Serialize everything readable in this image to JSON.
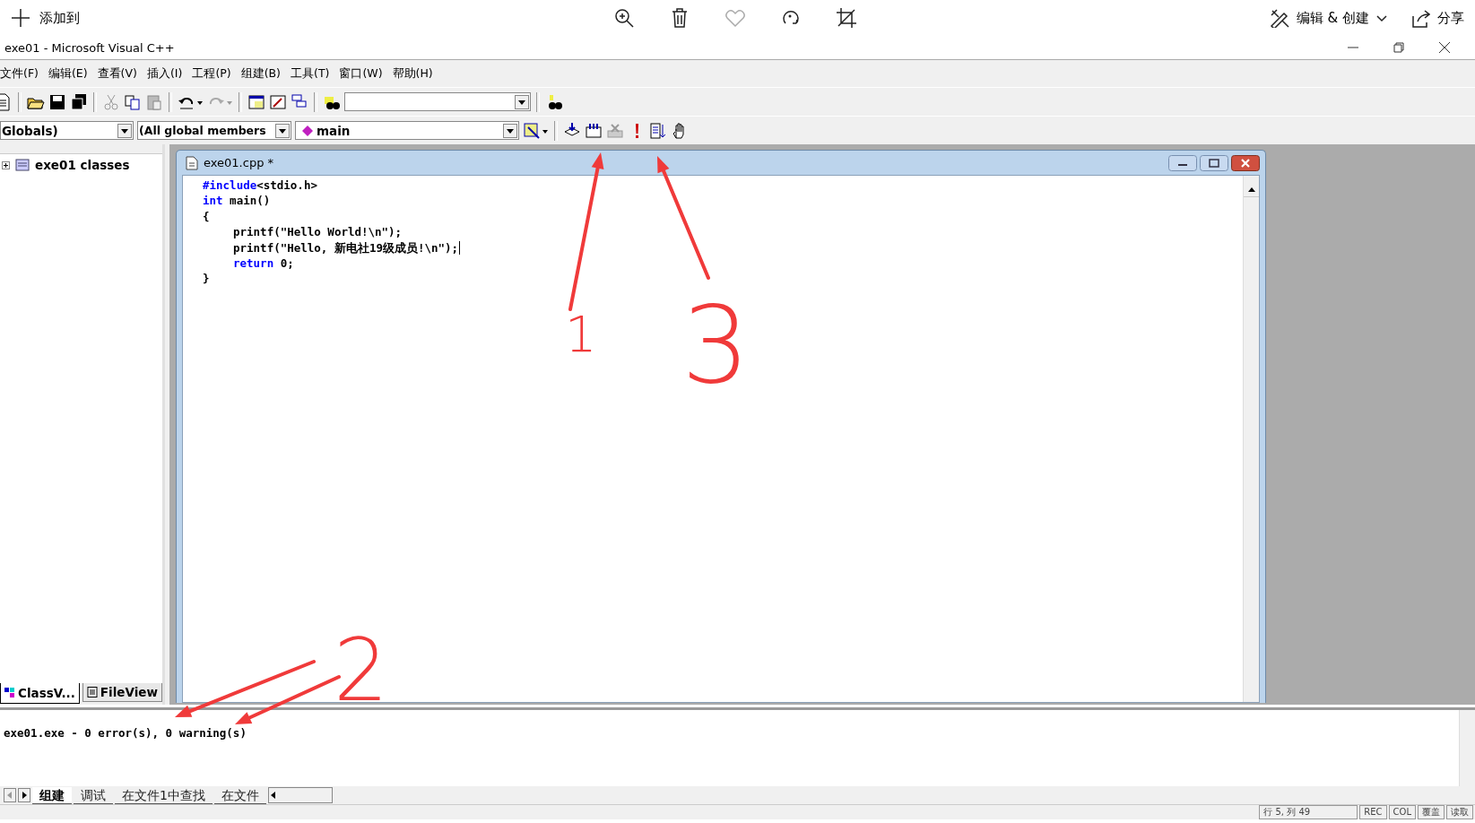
{
  "viewer_bar": {
    "add_label": "添加到",
    "edit_label": "编辑 & 创建",
    "share_label": "分享"
  },
  "window": {
    "title": "exe01 - Microsoft Visual C++"
  },
  "menu": [
    "文件(F)",
    "编辑(E)",
    "查看(V)",
    "插入(I)",
    "工程(P)",
    "组建(B)",
    "工具(T)",
    "窗口(W)",
    "帮助(H)"
  ],
  "combos": [
    {
      "value": "Globals)"
    },
    {
      "value": "(All global members"
    },
    {
      "value": "main"
    }
  ],
  "workspace": {
    "tree": [
      {
        "label": "exe01 classes",
        "expanded": false
      }
    ],
    "tabs": [
      {
        "label": "ClassV...",
        "selected": true
      },
      {
        "label": "FileView",
        "selected": false
      }
    ]
  },
  "editor": {
    "title": "exe01.cpp *",
    "lines": [
      {
        "has_caret": false,
        "tokens": [
          {
            "kind": "keyword",
            "text": "#include"
          },
          {
            "kind": "plain",
            "text": "<stdio.h>"
          }
        ]
      },
      {
        "has_caret": false,
        "tokens": [
          {
            "kind": "keyword",
            "text": "int"
          },
          {
            "kind": "plain",
            "text": " main()"
          }
        ]
      },
      {
        "has_caret": false,
        "tokens": [
          {
            "kind": "plain",
            "text": "{"
          }
        ]
      },
      {
        "has_caret": false,
        "indented": true,
        "tokens": [
          {
            "kind": "plain",
            "text": "printf(\"Hello World!\\n\");"
          }
        ]
      },
      {
        "has_caret": true,
        "indented": true,
        "tokens": [
          {
            "kind": "plain",
            "text": "printf(\"Hello, 新电社19级成员!\\n\");"
          }
        ]
      },
      {
        "has_caret": false,
        "indented": true,
        "tokens": [
          {
            "kind": "keyword",
            "text": "return"
          },
          {
            "kind": "plain",
            "text": " 0;"
          }
        ]
      },
      {
        "has_caret": false,
        "tokens": [
          {
            "kind": "plain",
            "text": "}"
          }
        ]
      }
    ]
  },
  "output": {
    "text": "exe01.exe - 0 error(s), 0 warning(s)",
    "tabs": [
      {
        "label": "组建",
        "selected": true
      },
      {
        "label": "调试",
        "selected": false
      },
      {
        "label": "在文件1中查找",
        "selected": false
      },
      {
        "label": "在文件",
        "selected": false
      }
    ]
  },
  "status_bar": [
    "行 5, 列 49",
    "REC",
    "COL",
    "覆盖",
    "读取"
  ],
  "annotations": [
    {
      "label": "1"
    },
    {
      "label": "2"
    },
    {
      "label": "3"
    }
  ]
}
